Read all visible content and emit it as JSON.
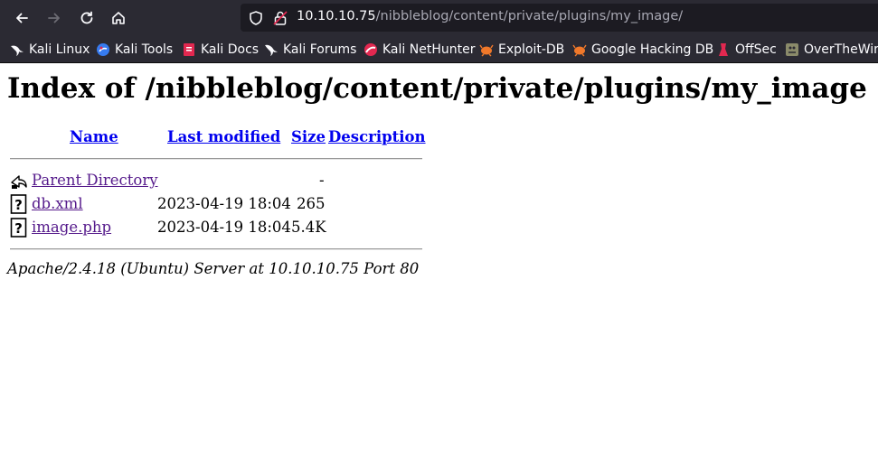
{
  "browser": {
    "url_host": "10.10.10.75",
    "url_path": "/nibbleblog/content/private/plugins/my_image/",
    "bookmarks": [
      {
        "label": "Kali Linux",
        "icon": "kali-dragon-icon"
      },
      {
        "label": "Kali Tools",
        "icon": "kali-tools-icon"
      },
      {
        "label": "Kali Docs",
        "icon": "kali-docs-icon"
      },
      {
        "label": "Kali Forums",
        "icon": "kali-forums-icon"
      },
      {
        "label": "Kali NetHunter",
        "icon": "nethunter-icon"
      },
      {
        "label": "Exploit-DB",
        "icon": "exploit-db-icon"
      },
      {
        "label": "Google Hacking DB",
        "icon": "ghdb-icon"
      },
      {
        "label": "OffSec",
        "icon": "offsec-icon"
      },
      {
        "label": "OverTheWire",
        "icon": "overthewire-icon"
      }
    ]
  },
  "page": {
    "title": "Index of /nibbleblog/content/private/plugins/my_image",
    "columns": {
      "name": "Name",
      "modified": "Last modified",
      "size": "Size",
      "description": "Description"
    },
    "rows": [
      {
        "name": "Parent Directory",
        "modified": "",
        "size": "-",
        "description": "",
        "icon": "back-folder-icon"
      },
      {
        "name": "db.xml",
        "modified": "2023-04-19 18:04",
        "size": "265",
        "description": "",
        "icon": "unknown-file-icon"
      },
      {
        "name": "image.php",
        "modified": "2023-04-19 18:04",
        "size": "5.4K",
        "description": "",
        "icon": "unknown-file-icon"
      }
    ],
    "footer": "Apache/2.4.18 (Ubuntu) Server at 10.10.10.75 Port 80"
  }
}
